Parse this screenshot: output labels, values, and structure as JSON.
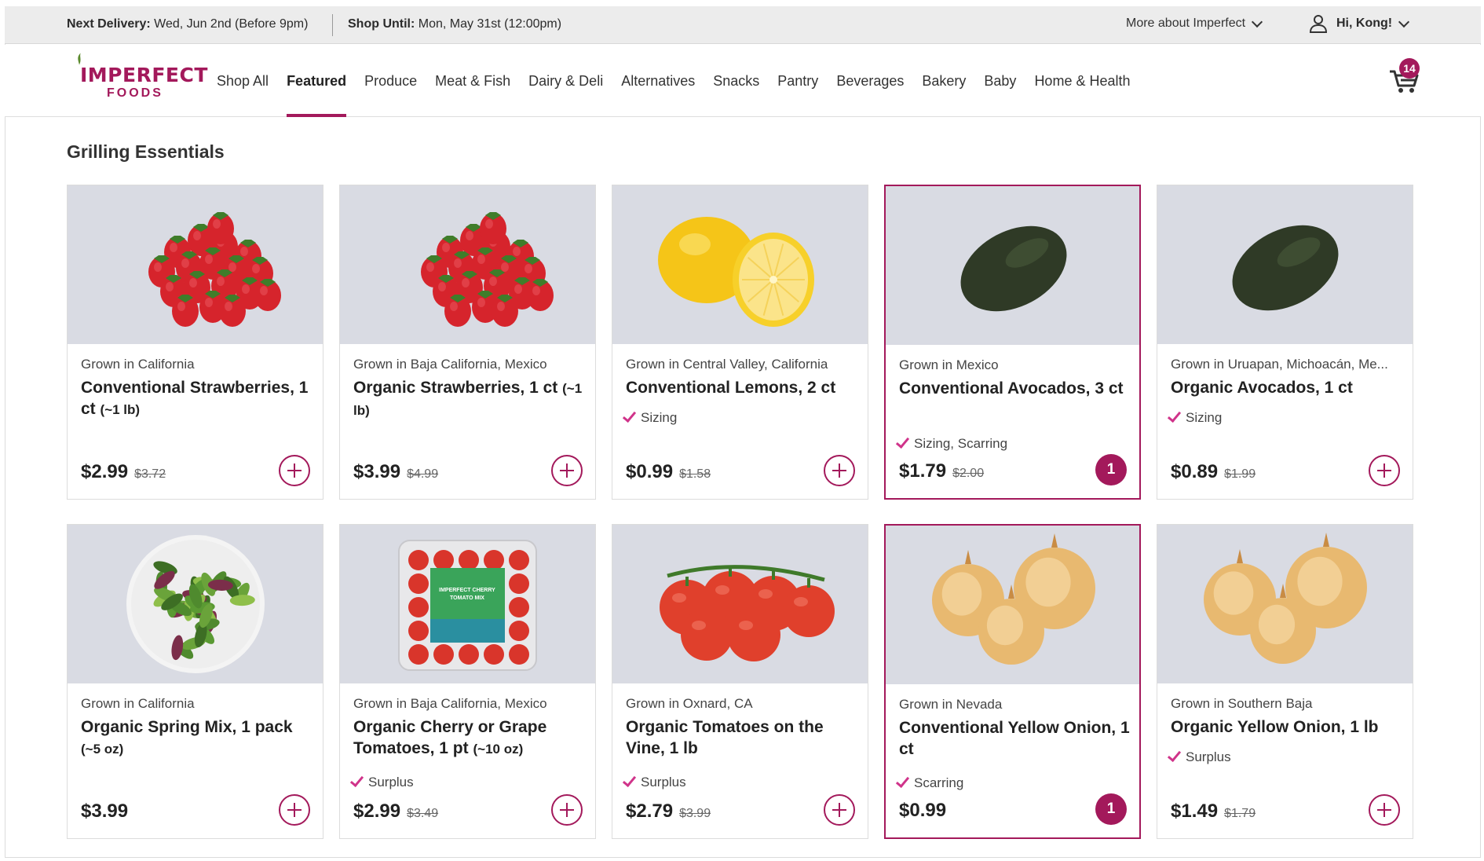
{
  "topbar": {
    "delivery_label": "Next Delivery:",
    "delivery_value": "Wed, Jun 2nd (Before 9pm)",
    "shop_label": "Shop Until:",
    "shop_value": "Mon, May 31st (12:00pm)",
    "more_link": "More about Imperfect",
    "greeting": "Hi, Kong!"
  },
  "brand": {
    "name": "IMPERFECT",
    "sub": "FOODS",
    "color": "#a3195b"
  },
  "nav": {
    "items": [
      "Shop All",
      "Featured",
      "Produce",
      "Meat & Fish",
      "Dairy & Deli",
      "Alternatives",
      "Snacks",
      "Pantry",
      "Beverages",
      "Bakery",
      "Baby",
      "Home & Health"
    ],
    "active": "Featured",
    "cart_count": "14"
  },
  "section": {
    "title": "Grilling Essentials"
  },
  "products": [
    {
      "origin": "Grown in California",
      "name": "Conventional Strawberries, 1 ct",
      "qty": "(~1 lb)",
      "tag": "",
      "price": "$2.99",
      "was": "$3.72",
      "in_cart": "",
      "image": "strawberries"
    },
    {
      "origin": "Grown in Baja California, Mexico",
      "name": "Organic Strawberries, 1 ct",
      "qty": "(~1 lb)",
      "tag": "",
      "price": "$3.99",
      "was": "$4.99",
      "in_cart": "",
      "image": "strawberries"
    },
    {
      "origin": "Grown in Central Valley, California",
      "name": "Conventional Lemons, 2 ct",
      "qty": "",
      "tag": "Sizing",
      "price": "$0.99",
      "was": "$1.58",
      "in_cart": "",
      "image": "lemons"
    },
    {
      "origin": "Grown in Mexico",
      "name": "Conventional Avocados, 3 ct",
      "qty": "",
      "tag": "Sizing, Scarring",
      "price": "$1.79",
      "was": "$2.00",
      "in_cart": "1",
      "image": "avocado"
    },
    {
      "origin": "Grown in Uruapan, Michoacán, Me...",
      "name": "Organic Avocados, 1 ct",
      "qty": "",
      "tag": "Sizing",
      "price": "$0.89",
      "was": "$1.99",
      "in_cart": "",
      "image": "avocado"
    },
    {
      "origin": "Grown in California",
      "name": "Organic Spring Mix, 1 pack",
      "qty": "(~5 oz)",
      "tag": "",
      "price": "$3.99",
      "was": "",
      "in_cart": "",
      "image": "greens"
    },
    {
      "origin": "Grown in Baja California, Mexico",
      "name": "Organic Cherry or Grape Tomatoes, 1 pt",
      "qty": "(~10 oz)",
      "tag": "Surplus",
      "price": "$2.99",
      "was": "$3.49",
      "in_cart": "",
      "image": "tomato-pack",
      "package_label": "IMPERFECT CHERRY TOMATO MIX"
    },
    {
      "origin": "Grown in Oxnard, CA",
      "name": "Organic Tomatoes on the Vine, 1 lb",
      "qty": "",
      "tag": "Surplus",
      "price": "$2.79",
      "was": "$3.99",
      "in_cart": "",
      "image": "tomatoes"
    },
    {
      "origin": "Grown in Nevada",
      "name": "Conventional Yellow Onion, 1 ct",
      "qty": "",
      "tag": "Scarring",
      "price": "$0.99",
      "was": "",
      "in_cart": "1",
      "image": "onions"
    },
    {
      "origin": "Grown in Southern Baja",
      "name": "Organic Yellow Onion, 1 lb",
      "qty": "",
      "tag": "Surplus",
      "price": "$1.49",
      "was": "$1.79",
      "in_cart": "",
      "image": "onions"
    }
  ]
}
